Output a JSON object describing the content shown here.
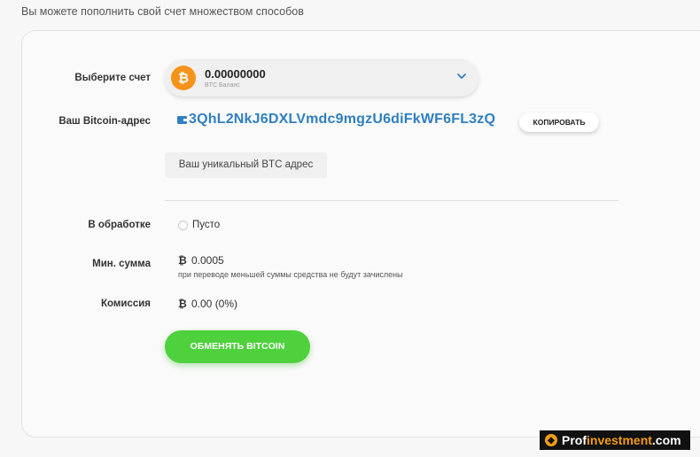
{
  "intro_text": "Вы можете пополнить свой счет множеством способов",
  "account": {
    "label": "Выберите счет",
    "balance": "0.00000000",
    "balance_caption": "BTC Баланс",
    "coin_symbol": "₿"
  },
  "address": {
    "label": "Ваш Bitcoin-адрес",
    "value": "3QhL2NkJ6DXLVmdc9mgzU6diFkWF6FL3zQ",
    "copy_label": "КОПИРОВАТЬ",
    "hint": "Ваш уникальный BTC адрес"
  },
  "processing": {
    "label": "В обработке",
    "value": "Пусто"
  },
  "min_amount": {
    "label": "Мин. сумма",
    "symbol": "₿",
    "value": "0.0005",
    "note": "при переводе меньшей суммы средства не будут зачислены"
  },
  "commission": {
    "label": "Комиссия",
    "symbol": "₿",
    "value": "0.00 (0%)"
  },
  "exchange_button": "ОБМЕНЯТЬ BITCOIN",
  "watermark": {
    "part1": "Prof",
    "part2": "investment",
    "part3": ".com"
  },
  "colors": {
    "bitcoin_orange": "#f7931a",
    "address_blue": "#2f7fc1",
    "button_green": "#4ed13c"
  }
}
